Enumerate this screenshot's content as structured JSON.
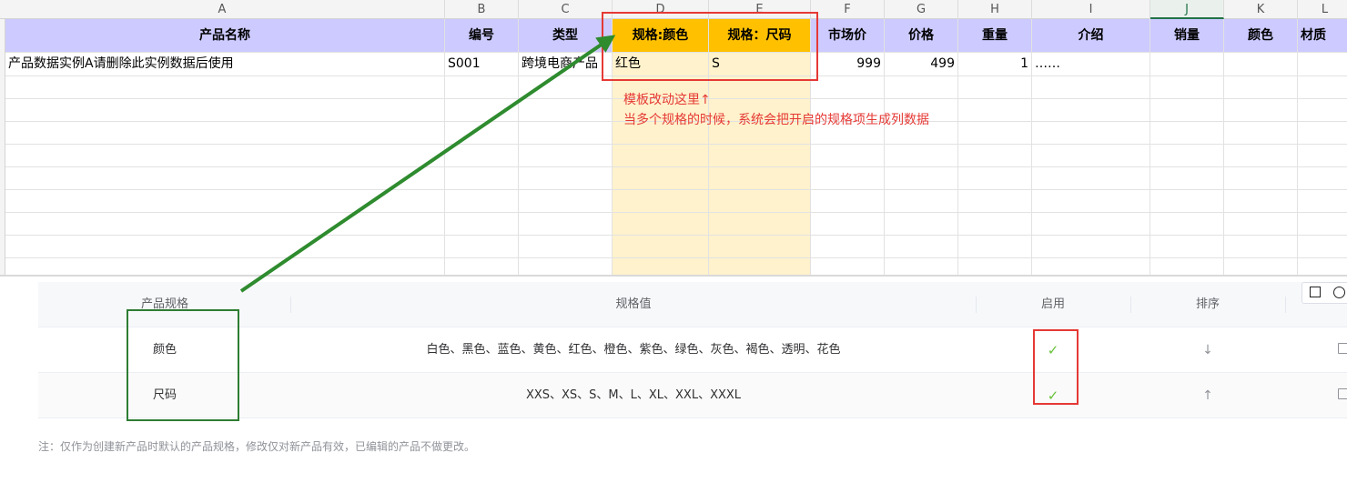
{
  "sheet": {
    "column_letters": [
      "A",
      "B",
      "C",
      "D",
      "E",
      "F",
      "G",
      "H",
      "I",
      "J",
      "K",
      "L"
    ],
    "selected_column": "J",
    "header_row": [
      "产品名称",
      "编号",
      "类型",
      "规格:颜色",
      "规格：尺码",
      "市场价",
      "价格",
      "重量",
      "介绍",
      "销量",
      "颜色",
      "材质"
    ],
    "data_row": [
      "产品数据实例A请删除此实例数据后使用",
      "S001",
      "跨境电商产品",
      "红色",
      "S",
      "999",
      "499",
      "1",
      "……",
      "",
      "",
      ""
    ],
    "highlight_color": "#fff2cc",
    "spec_header_color": "#ffc000",
    "header_color": "#cccaff"
  },
  "annotation": {
    "line1": "模板改动这里↑",
    "line2": "当多个规格的时候，系统会把开启的规格项生成列数据",
    "text_color": "#e53935",
    "arrow_color": "#2e8b2e"
  },
  "panel": {
    "columns": [
      "产品规格",
      "规格值",
      "启用",
      "排序"
    ],
    "rows": [
      {
        "name": "颜色",
        "values": "白色、黑色、蓝色、黄色、红色、橙色、紫色、绿色、灰色、褐色、透明、花色",
        "enabled": "✓",
        "sort_icon": "↓"
      },
      {
        "name": "尺码",
        "values": "XXS、XS、S、M、L、XL、XXL、XXXL",
        "enabled": "✓",
        "sort_icon": "↑"
      }
    ],
    "note": "注：仅作为创建新产品时默认的产品规格，修改仅对新产品有效，已编辑的产品不做更改。"
  }
}
